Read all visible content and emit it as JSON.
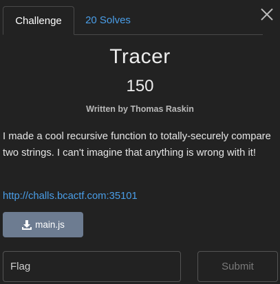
{
  "modal": {
    "close_icon": "close-icon"
  },
  "tabs": {
    "challenge_label": "Challenge",
    "solves_label": "20 Solves"
  },
  "challenge": {
    "name": "Tracer",
    "points": "150",
    "author": "Written by Thomas Raskin",
    "description": "I made a cool recursive function to totally-securely compare two strings. I can't imagine that anything is wrong with it!",
    "link": "http://challs.bcactf.com:35101"
  },
  "files": [
    {
      "label": "main.js",
      "icon": "download-icon"
    }
  ],
  "form": {
    "flag_placeholder": "Flag",
    "flag_value": "",
    "submit_label": "Submit"
  },
  "colors": {
    "background": "#222222",
    "link": "#4a9ee8",
    "file_button": "#6d7c91",
    "border": "#4a4a4a"
  }
}
